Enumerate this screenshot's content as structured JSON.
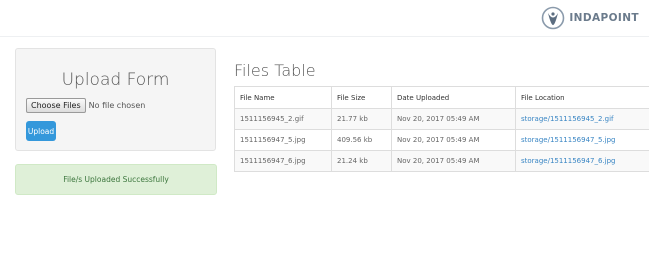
{
  "header": {
    "logo_text": "INDAPOINT",
    "logo_icon": "indapoint-logo-icon",
    "brand_color": "#6b7b8c"
  },
  "upload_form": {
    "title": "Upload Form",
    "choose_files_label": "Choose Files",
    "file_status": "No file chosen",
    "upload_label": "Upload",
    "upload_color": "#3498db"
  },
  "alert": {
    "message": "File/s Uploaded Successfully",
    "color": "#dff0d8"
  },
  "files_table": {
    "title": "Files Table",
    "columns": [
      "File Name",
      "File Size",
      "Date Uploaded",
      "File Location"
    ],
    "rows": [
      {
        "name": "1511156945_2.gif",
        "size": "21.77 kb",
        "date": "Nov 20, 2017 05:49 AM",
        "location": "storage/1511156945_2.gif"
      },
      {
        "name": "1511156947_5.jpg",
        "size": "409.56 kb",
        "date": "Nov 20, 2017 05:49 AM",
        "location": "storage/1511156947_5.jpg"
      },
      {
        "name": "1511156947_6.jpg",
        "size": "21.24 kb",
        "date": "Nov 20, 2017 05:49 AM",
        "location": "storage/1511156947_6.jpg"
      }
    ]
  }
}
